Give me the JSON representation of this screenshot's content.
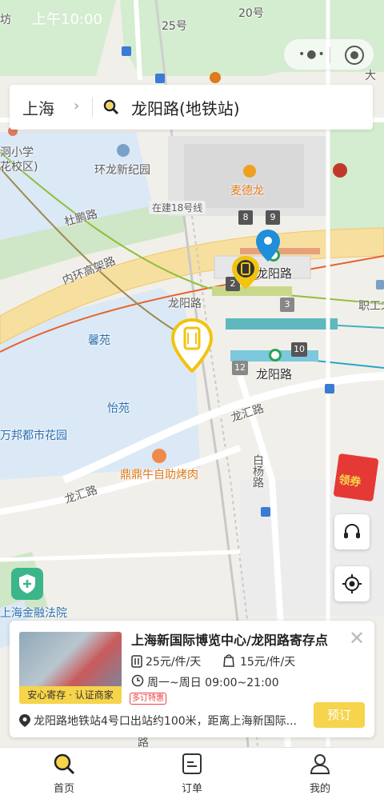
{
  "status_bar": {
    "time": "上午10:00"
  },
  "search": {
    "city": "上海",
    "query": "龙阳路(地铁站)"
  },
  "map_labels": {
    "road_20": "20号",
    "road_25": "25号",
    "school": "洞小学",
    "school_campus": "花校区)",
    "huanlong": "环龙新纪园",
    "mcdonalds": "麦德龙",
    "dupeng_road": "杜鹏路",
    "metro18": "在建18号线",
    "inner_ring": "内环高架路",
    "longyang_road": "龙阳路",
    "station_top": "龙阳路",
    "station_bottom": "龙阳路",
    "xinyuan": "馨苑",
    "yiyuan": "怡苑",
    "wanbang": "万邦都市花园",
    "longhui_road_1": "龙汇路",
    "longhui_road_2": "龙汇路",
    "baiyang_road": "白杨路",
    "dingding": "鼎鼎牛自助烤肉",
    "court": "上海金融法院",
    "staff": "职工之",
    "da": "大",
    "fang": "坊",
    "lu": "路",
    "exit_2": "2",
    "exit_3": "3",
    "exit_8": "8",
    "exit_9": "9",
    "exit_10": "10",
    "exit_12": "12"
  },
  "coupon": {
    "label": "领券"
  },
  "card": {
    "title": "上海新国际博览中心/龙阳路寄存点",
    "badge": "安心寄存 · 认证商家",
    "price_luggage": "25元/件/天",
    "price_bag": "15元/件/天",
    "hours": "周一~周日 09:00~21:00",
    "promo": "多订特惠",
    "address": "龙阳路地铁站4号口出站约100米，距离上海新国际...",
    "book_label": "预订"
  },
  "tabs": [
    {
      "label": "首页",
      "icon": "search-icon"
    },
    {
      "label": "订单",
      "icon": "order-icon"
    },
    {
      "label": "我的",
      "icon": "profile-icon"
    }
  ],
  "colors": {
    "accent": "#f6d44b",
    "pin_blue": "#1e8fd8",
    "pin_yellow": "#f1c40f",
    "water": "#dbe8f5",
    "green": "#d4ecd0",
    "highway": "#f7dfa0"
  }
}
